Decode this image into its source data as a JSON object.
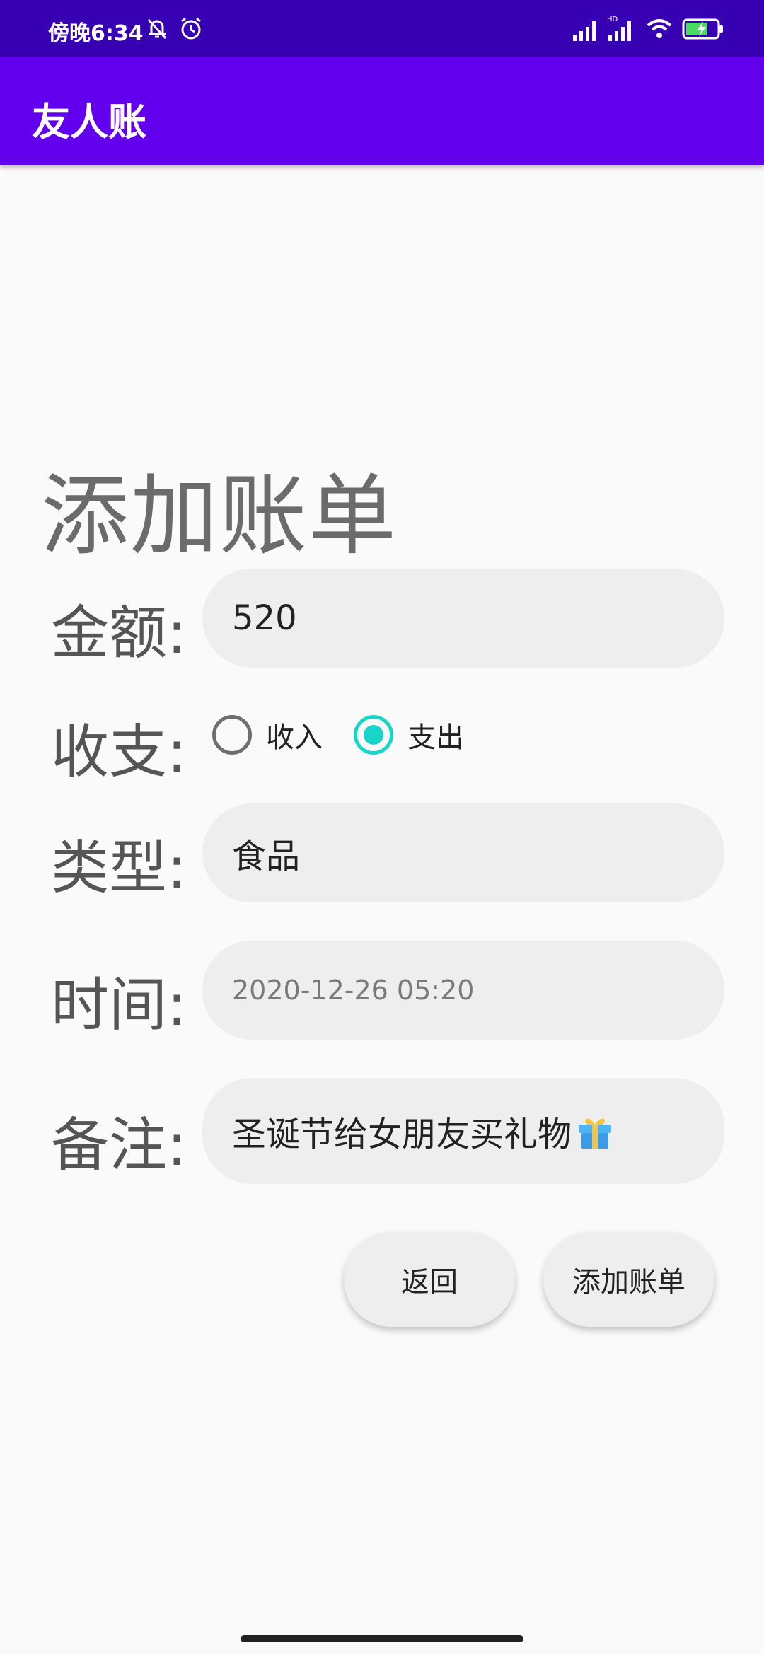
{
  "status_bar": {
    "time": "傍晚6:34",
    "icons": [
      "bell-off-icon",
      "alarm-icon",
      "signal-icon",
      "signal-hd-icon",
      "wifi-icon",
      "battery-charging-icon"
    ]
  },
  "app_bar": {
    "title": "友人账"
  },
  "page": {
    "title": "添加账单"
  },
  "form": {
    "amount": {
      "label": "金额:",
      "value": "520"
    },
    "type": {
      "label": "收支:",
      "options": [
        {
          "label": "收入",
          "selected": false
        },
        {
          "label": "支出",
          "selected": true
        }
      ]
    },
    "category": {
      "label": "类型:",
      "value": "食品"
    },
    "time": {
      "label": "时间:",
      "placeholder": "2020-12-26 05:20"
    },
    "note": {
      "label": "备注:",
      "value": "圣诞节给女朋友买礼物"
    }
  },
  "buttons": {
    "back": "返回",
    "add": "添加账单"
  },
  "colors": {
    "status_bar": "#3700b3",
    "app_bar": "#6200ee",
    "radio_accent": "#17d6c8",
    "field_bg": "#eeeeee"
  }
}
